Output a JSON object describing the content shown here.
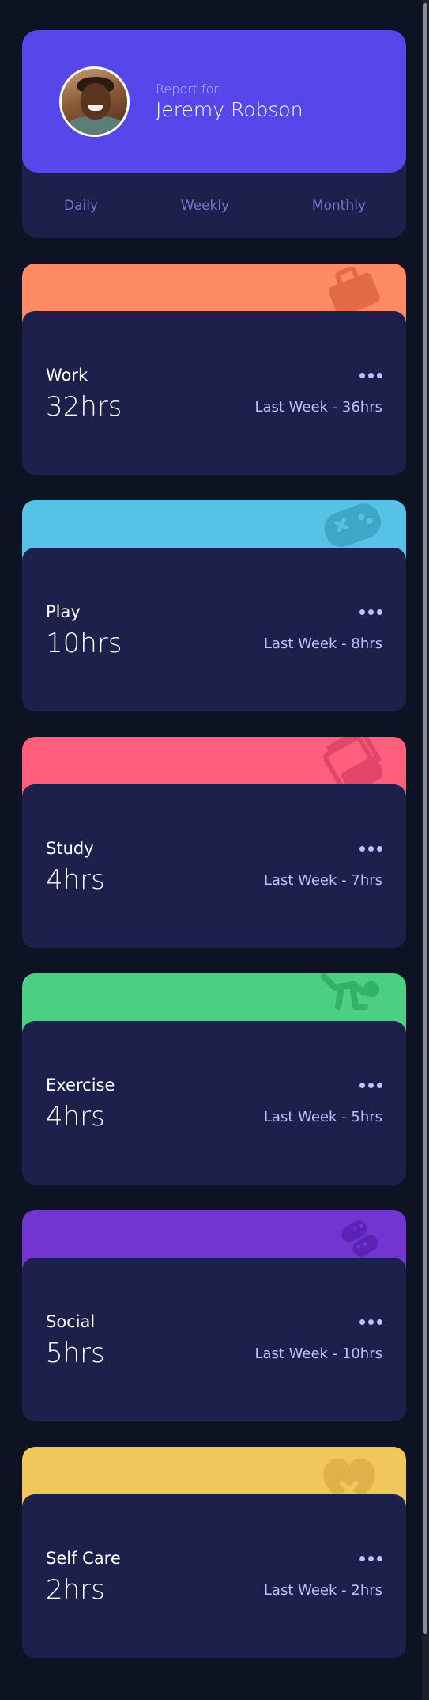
{
  "profile": {
    "report_for": "Report for",
    "name": "Jeremy Robson"
  },
  "tabs": [
    {
      "label": "Daily",
      "active": false
    },
    {
      "label": "Weekly",
      "active": false
    },
    {
      "label": "Monthly",
      "active": false
    }
  ],
  "activities": [
    {
      "title": "Work",
      "current": "32hrs",
      "previous": "Last Week - 36hrs",
      "color": "#ff8b64",
      "icon": "briefcase-icon"
    },
    {
      "title": "Play",
      "current": "10hrs",
      "previous": "Last Week - 8hrs",
      "color": "#55c2e6",
      "icon": "gamepad-icon"
    },
    {
      "title": "Study",
      "current": "4hrs",
      "previous": "Last Week - 7hrs",
      "color": "#ff5e7d",
      "icon": "book-icon"
    },
    {
      "title": "Exercise",
      "current": "4hrs",
      "previous": "Last Week - 5hrs",
      "color": "#4bcf82",
      "icon": "running-person-icon"
    },
    {
      "title": "Social",
      "current": "5hrs",
      "previous": "Last Week - 10hrs",
      "color": "#7335d2",
      "icon": "chat-bubbles-icon"
    },
    {
      "title": "Self Care",
      "current": "2hrs",
      "previous": "Last Week - 2hrs",
      "color": "#f1c75b",
      "icon": "heart-icon"
    }
  ],
  "colors": {
    "background": "#0e1323",
    "card": "#1c204b",
    "accent": "#5747ea",
    "muted_text": "#bbc0ff",
    "tab_text": "#7078c9"
  }
}
